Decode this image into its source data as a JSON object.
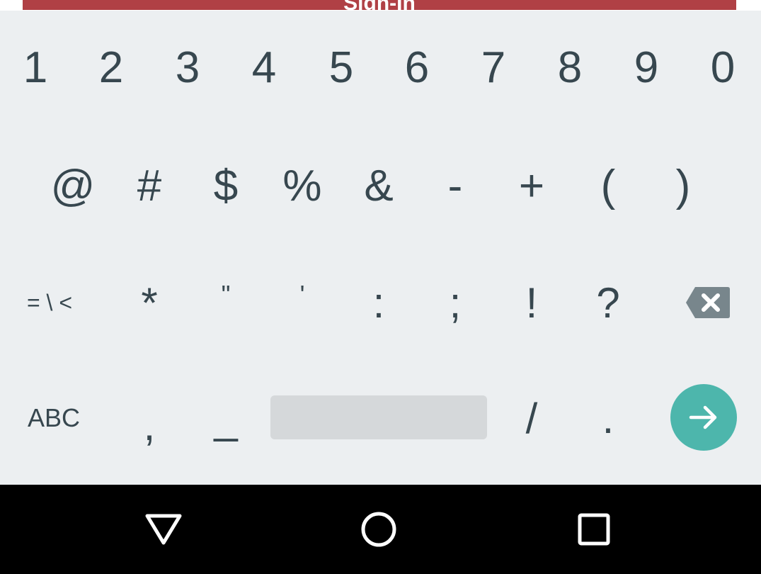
{
  "signin": {
    "label": "Sign-In",
    "color": "#b04045"
  },
  "keyboard": {
    "row1": [
      "1",
      "2",
      "3",
      "4",
      "5",
      "6",
      "7",
      "8",
      "9",
      "0"
    ],
    "row2": [
      "@",
      "#",
      "$",
      "%",
      "&",
      "-",
      "+",
      "(",
      ")"
    ],
    "row3": {
      "more_symbols": "= \\ <",
      "keys": [
        "*",
        "\"",
        "'",
        ":",
        ";",
        "!",
        "?"
      ],
      "backspace_icon": "backspace-icon"
    },
    "row4": {
      "abc": "ABC",
      "comma": ",",
      "underscore": "_",
      "slash": "/",
      "period": ".",
      "enter_icon": "arrow-right-icon",
      "enter_color": "#4db6ac"
    },
    "key_color": "#37474f",
    "background": "#eceff1"
  },
  "navbar": {
    "back_icon": "triangle-back-icon",
    "home_icon": "circle-home-icon",
    "recents_icon": "square-recents-icon"
  }
}
